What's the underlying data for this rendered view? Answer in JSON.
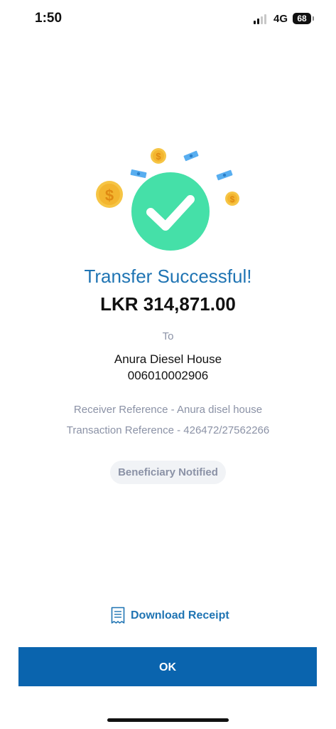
{
  "status_bar": {
    "time": "1:50",
    "network": "4G",
    "battery": "68"
  },
  "illustration": {
    "icon": "success-check-with-coins-icon",
    "check_color": "#45e0a8",
    "coin_color": "#f6c545",
    "bill_color": "#58aef0"
  },
  "transfer": {
    "title": "Transfer Successful!",
    "amount": "LKR 314,871.00",
    "to_label": "To",
    "recipient_name": "Anura Diesel House",
    "recipient_account": "006010002906",
    "receiver_reference": "Receiver Reference - Anura disel house",
    "transaction_reference": "Transaction Reference - 426472/27562266",
    "beneficiary_status": "Beneficiary Notified"
  },
  "actions": {
    "download_receipt_label": "Download Receipt",
    "download_icon": "receipt-icon",
    "ok_label": "OK"
  },
  "colors": {
    "accent": "#1f74b3",
    "button": "#0a64ae",
    "muted_text": "#8b92a6"
  }
}
